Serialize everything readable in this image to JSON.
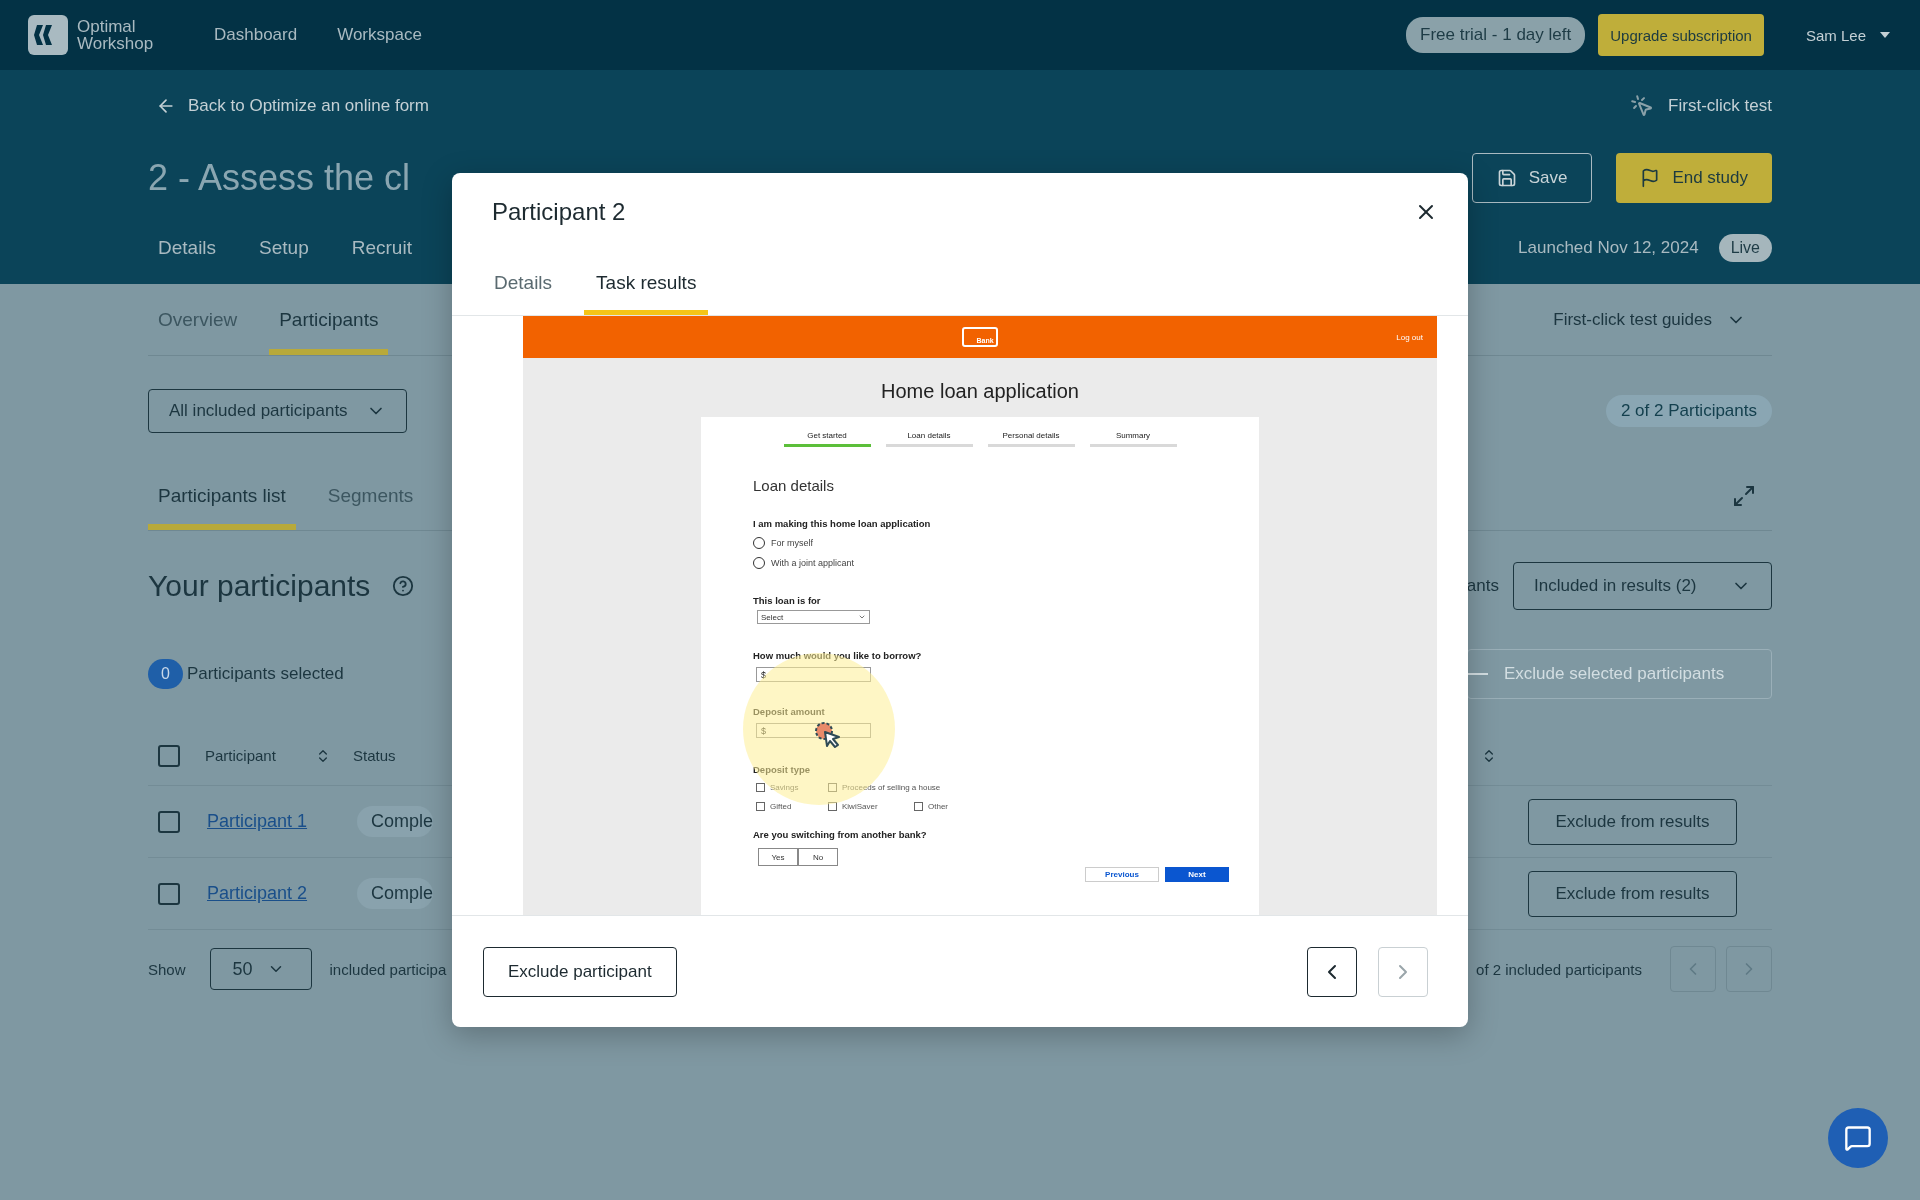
{
  "top_nav": {
    "logo_text": "Optimal Workshop",
    "items": [
      "Dashboard",
      "Workspace"
    ],
    "trial_badge": "Free trial - 1 day left",
    "upgrade_button": "Upgrade subscription",
    "user_name": "Sam Lee"
  },
  "study_header": {
    "back_link": "Back to Optimize an online form",
    "test_type": "First-click test",
    "title": "2 - Assess the cl",
    "save_button": "Save",
    "end_button": "End study",
    "tabs": [
      "Details",
      "Setup",
      "Recruit"
    ],
    "launched": "Launched Nov 12, 2024",
    "status": "Live"
  },
  "results_tabs": [
    {
      "label": "Overview",
      "selected": false
    },
    {
      "label": "Participants",
      "selected": true
    }
  ],
  "guides": "First-click test guides",
  "filter": "All included participants",
  "count_badge": "2 of 2 Participants",
  "list_tabs": [
    {
      "label": "Participants list",
      "selected": true
    },
    {
      "label": "Segments",
      "selected": false
    }
  ],
  "section_title": "Your participants",
  "results_filter_label": "ants",
  "results_filter": "Included in results (2)",
  "selected_count": "0",
  "selected_label": "Participants selected",
  "exclude_selected": {
    "label": "Exclude selected participants",
    "disabled": true
  },
  "table": {
    "header_checked": false,
    "columns": [
      "Participant",
      "Status"
    ],
    "rows": [
      {
        "checked": false,
        "participant": "Participant 1",
        "status": "Comple",
        "action": "Exclude from results"
      },
      {
        "checked": false,
        "participant": "Participant 2",
        "status": "Comple",
        "action": "Exclude from results"
      }
    ]
  },
  "footer": {
    "show_label": "Show",
    "page_size": "50",
    "range_left": "included participa",
    "range_right": "of 2 included participants",
    "prev_disabled": true,
    "next_disabled": true
  },
  "modal": {
    "title": "Participant 2",
    "tabs": [
      {
        "label": "Details",
        "selected": false
      },
      {
        "label": "Task results",
        "selected": true
      }
    ],
    "task_screenshot": {
      "logo_text": "Bank",
      "logout": "Log out",
      "heading": "Home loan application",
      "steps": [
        {
          "label": "Get started",
          "selected": true
        },
        {
          "label": "Loan details",
          "selected": false
        },
        {
          "label": "Personal details",
          "selected": false
        },
        {
          "label": "Summary",
          "selected": false
        }
      ],
      "section": "Loan details",
      "fields": [
        {
          "kind": "radio",
          "label": "I am making this home loan application",
          "options": [
            {
              "label": "For myself",
              "checked": false
            },
            {
              "label": "With a joint applicant",
              "checked": false
            }
          ]
        },
        {
          "kind": "select",
          "label": "This loan is for",
          "value": "Select"
        },
        {
          "kind": "money",
          "label": "How much would you like to borrow?",
          "prefix": "$"
        },
        {
          "kind": "money",
          "label": "Deposit amount",
          "prefix": "$"
        },
        {
          "kind": "checkboxes",
          "label": "Deposit type",
          "rows": [
            [
              {
                "label": "Savings",
                "checked": false
              },
              {
                "label": "Proceeds of selling a house",
                "checked": false
              }
            ],
            [
              {
                "label": "Gifted",
                "checked": false
              },
              {
                "label": "KiwiSaver",
                "checked": false
              },
              {
                "label": "Other",
                "checked": false
              }
            ]
          ]
        },
        {
          "kind": "toggle",
          "label": "Are you switching from another bank?",
          "options": [
            "Yes",
            "No"
          ]
        }
      ],
      "buttons": [
        {
          "label": "Previous",
          "kind": "secondary"
        },
        {
          "label": "Next",
          "kind": "primary"
        }
      ]
    },
    "exclude_button": "Exclude participant",
    "prev_disabled": false,
    "next_disabled": true
  }
}
